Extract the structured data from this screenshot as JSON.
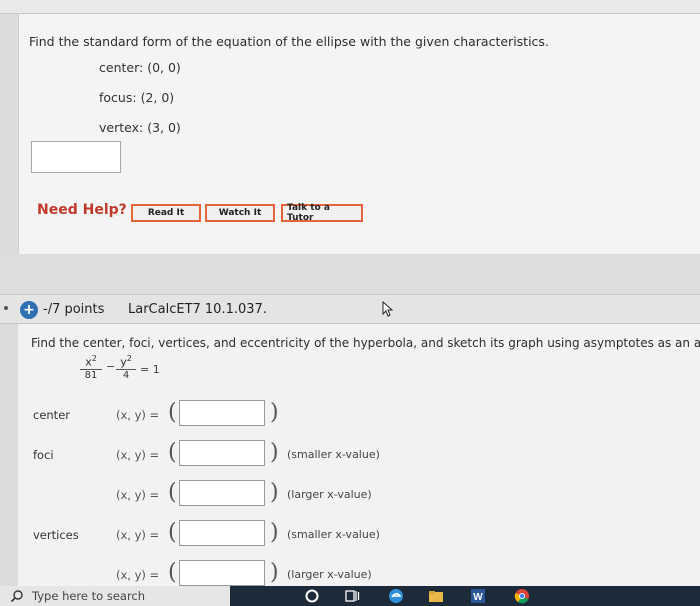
{
  "question1": {
    "prompt": "Find the standard form of the equation of the ellipse with the given characteristics.",
    "center_label": "center:",
    "center_value": "(0, 0)",
    "focus_label": "focus:",
    "focus_value": "(2, 0)",
    "vertex_label": "vertex:",
    "vertex_value": "(3, 0)",
    "need_help": "Need Help?",
    "read_it": "Read It",
    "watch_it": "Watch It",
    "talk_to_tutor": "Talk to a Tutor"
  },
  "question2": {
    "points": "-/7 points",
    "id": "LarCalcET7 10.1.037.",
    "prompt": "Find the center, foci, vertices, and eccentricity of the hyperbola, and sketch its graph using asymptotes as an aid.",
    "eq_x": "x",
    "eq_y": "y",
    "eq_exp": "2",
    "eq_den1": "81",
    "eq_den2": "4",
    "eq_minus": "−",
    "eq_rhs": "= 1",
    "xy_label": "(x, y) =",
    "rows": [
      {
        "label": "center",
        "note": ""
      },
      {
        "label": "foci",
        "note": "(smaller x-value)"
      },
      {
        "label": "",
        "note": "(larger x-value)"
      },
      {
        "label": "vertices",
        "note": "(smaller x-value)"
      },
      {
        "label": "",
        "note": "(larger x-value)"
      }
    ]
  },
  "taskbar": {
    "search_placeholder": "Type here to search"
  },
  "colors": {
    "need_help": "#c03a2b",
    "button_border": "#e2663a",
    "plus_badge": "#2f6fb3",
    "taskbar": "#1c2a3a"
  },
  "icons": [
    "plus-icon",
    "cursor-icon",
    "search-icon",
    "task-view-icon",
    "edge-icon",
    "file-explorer-icon",
    "word-icon",
    "chrome-icon",
    "cortana-icon"
  ]
}
